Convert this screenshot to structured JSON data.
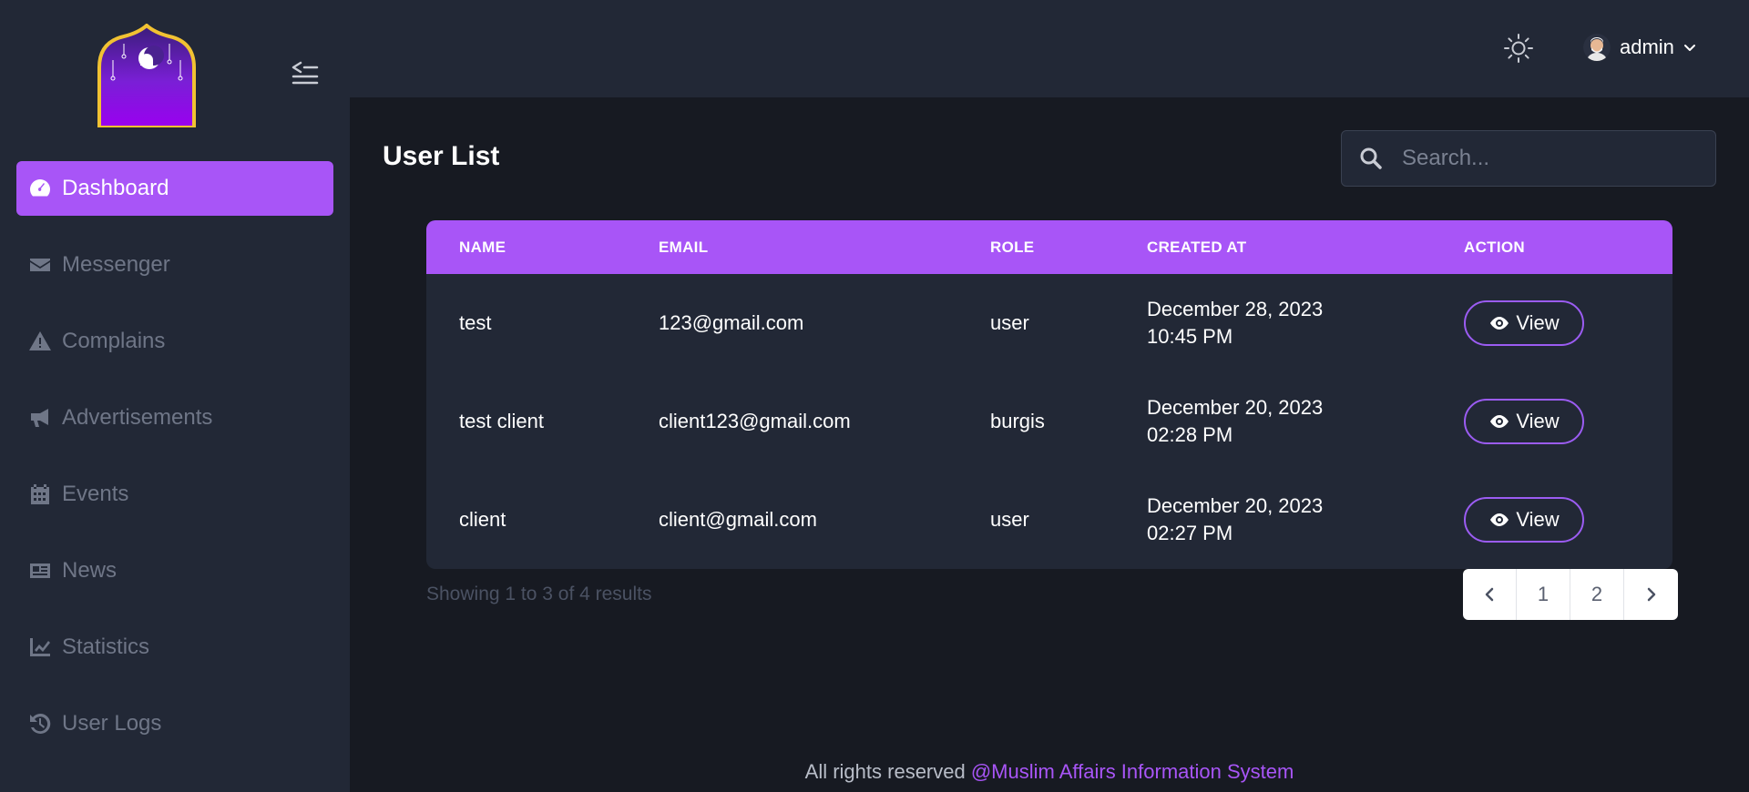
{
  "sidebar": {
    "items": [
      {
        "label": "Dashboard",
        "icon": "tachometer-icon",
        "active": true
      },
      {
        "label": "Messenger",
        "icon": "envelope-icon"
      },
      {
        "label": "Complains",
        "icon": "warning-icon"
      },
      {
        "label": "Advertisements",
        "icon": "megaphone-icon"
      },
      {
        "label": "Events",
        "icon": "calendar-icon"
      },
      {
        "label": "News",
        "icon": "newspaper-icon"
      },
      {
        "label": "Statistics",
        "icon": "chart-line-icon"
      },
      {
        "label": "User Logs",
        "icon": "history-icon"
      }
    ]
  },
  "header": {
    "user_name": "admin"
  },
  "main": {
    "title": "User List",
    "search_placeholder": "Search...",
    "columns": [
      "NAME",
      "EMAIL",
      "ROLE",
      "CREATED AT",
      "ACTION"
    ],
    "rows": [
      {
        "name": "test",
        "email": "123@gmail.com",
        "role": "user",
        "date": "December 28, 2023",
        "time": "10:45 PM",
        "action": "View"
      },
      {
        "name": "test client",
        "email": "client123@gmail.com",
        "role": "burgis",
        "date": "December 20, 2023",
        "time": "02:28 PM",
        "action": "View"
      },
      {
        "name": "client",
        "email": "client@gmail.com",
        "role": "user",
        "date": "December 20, 2023",
        "time": "02:27 PM",
        "action": "View"
      }
    ],
    "showing": "Showing 1 to 3 of 4 results",
    "pages": [
      "1",
      "2"
    ]
  },
  "footer": {
    "text": "All rights reserved ",
    "brand": "@Muslim Affairs Information System"
  },
  "colors": {
    "accent": "#a855f7",
    "sidebar_bg": "#222836",
    "page_bg": "#171a22"
  }
}
